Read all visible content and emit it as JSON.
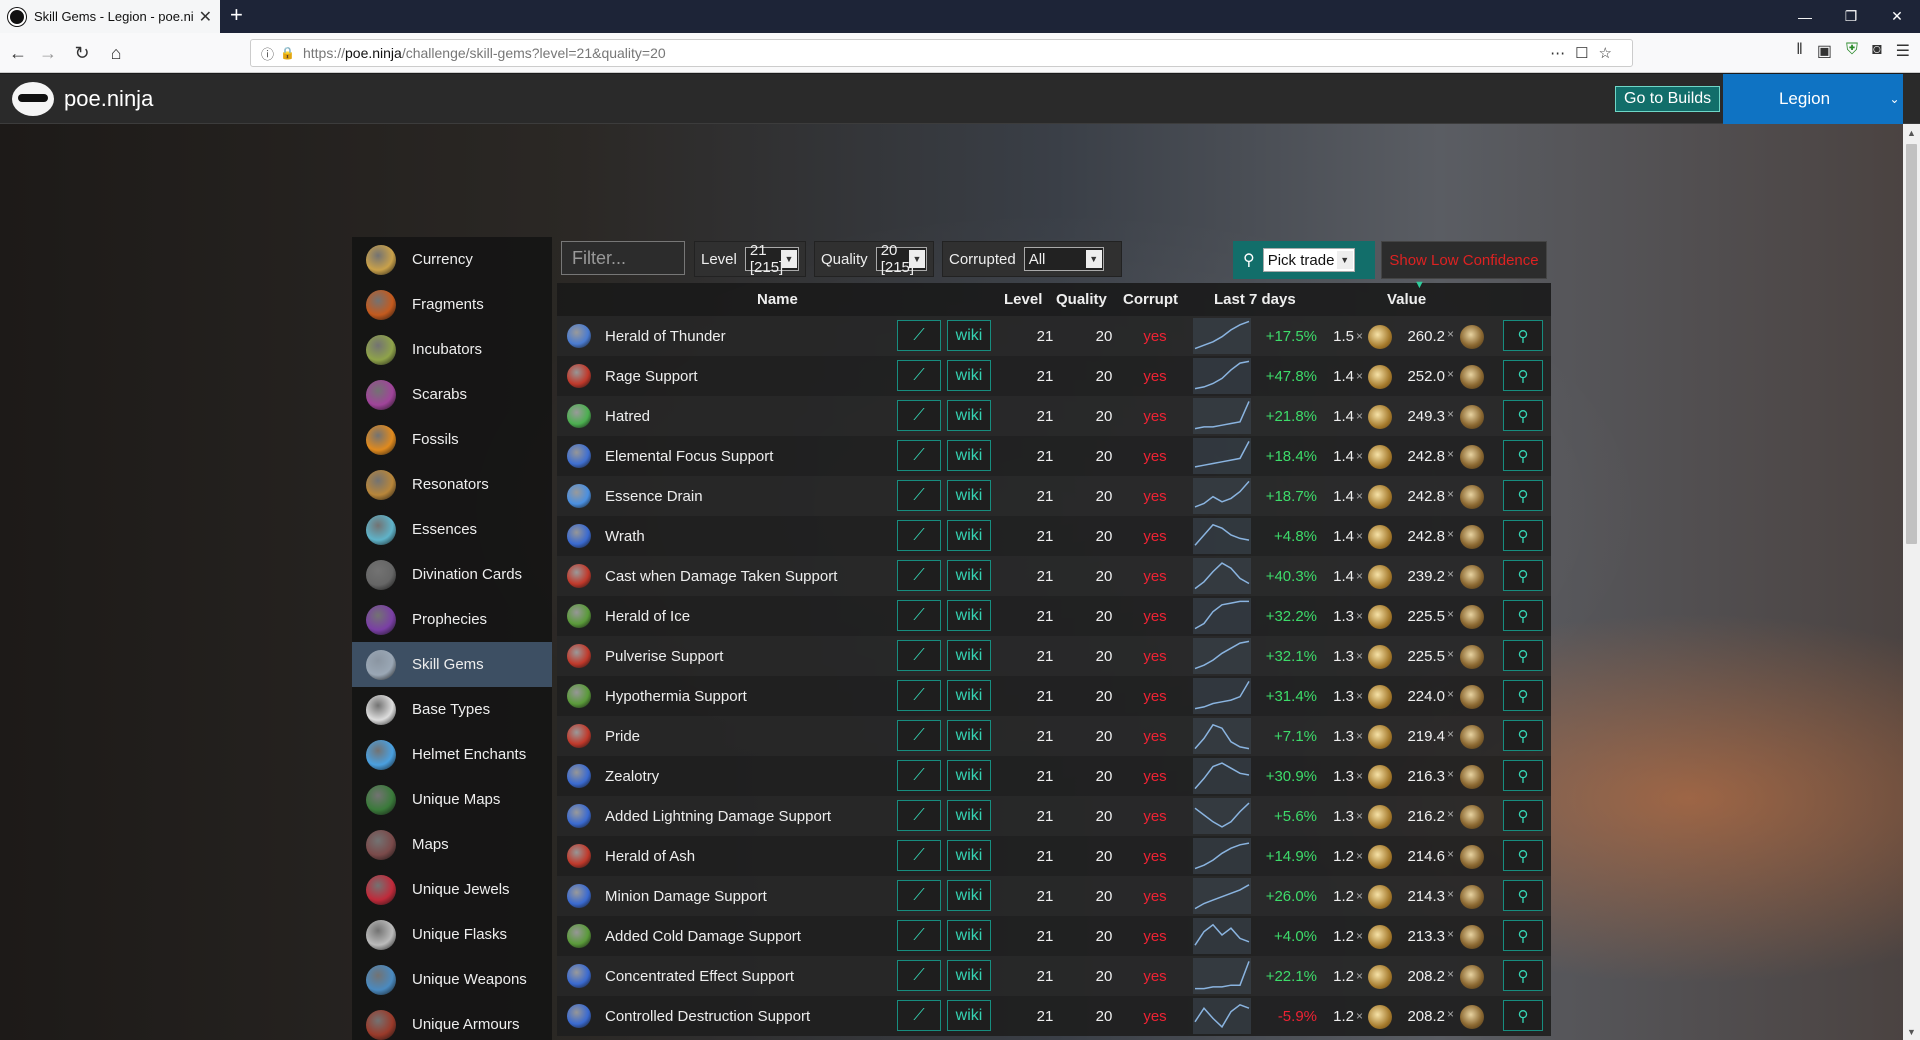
{
  "browser": {
    "tab_title": "Skill Gems - Legion - poe.ninj",
    "url_prefix": "https://",
    "url_domain": "poe.ninja",
    "url_path": "/challenge/skill-gems?level=21&quality=20"
  },
  "header": {
    "brand": "poe.ninja",
    "builds_button": "Go to Builds",
    "league": "Legion"
  },
  "sidebar": [
    {
      "label": "Currency",
      "color": "#c9a14a"
    },
    {
      "label": "Fragments",
      "color": "#c45a1e"
    },
    {
      "label": "Incubators",
      "color": "#8fa34a"
    },
    {
      "label": "Scarabs",
      "color": "#a0449a"
    },
    {
      "label": "Fossils",
      "color": "#e08a1e"
    },
    {
      "label": "Resonators",
      "color": "#b8863a"
    },
    {
      "label": "Essences",
      "color": "#5fb3c9"
    },
    {
      "label": "Divination Cards",
      "color": "#666666"
    },
    {
      "label": "Prophecies",
      "color": "#7a3fa5"
    },
    {
      "label": "Skill Gems",
      "color": "#9aa7b5",
      "active": true
    },
    {
      "label": "Base Types",
      "color": "#dddddd"
    },
    {
      "label": "Helmet Enchants",
      "color": "#4aa0e0"
    },
    {
      "label": "Unique Maps",
      "color": "#3a7a3a"
    },
    {
      "label": "Maps",
      "color": "#7a4a4a"
    },
    {
      "label": "Unique Jewels",
      "color": "#c02a3a"
    },
    {
      "label": "Unique Flasks",
      "color": "#bbbbbb"
    },
    {
      "label": "Unique Weapons",
      "color": "#4a8ac0"
    },
    {
      "label": "Unique Armours",
      "color": "#9a3a2a"
    }
  ],
  "controls": {
    "filter_placeholder": "Filter...",
    "level_label": "Level",
    "level_value": "21 [215]",
    "quality_label": "Quality",
    "quality_value": "20 [215]",
    "corrupted_label": "Corrupted",
    "corrupted_value": "All",
    "trade_value": "Pick trade",
    "low_confidence": "Show Low Confidence"
  },
  "table": {
    "headers": {
      "name": "Name",
      "level": "Level",
      "quality": "Quality",
      "corrupt": "Corrupt",
      "last7": "Last 7 days",
      "value": "Value"
    },
    "chart_button": "⟋",
    "wiki_button": "wiki",
    "rows": [
      {
        "name": "Herald of Thunder",
        "level": "21",
        "quality": "20",
        "corrupt": "yes",
        "change": "+17.5%",
        "ex": "1.5",
        "chaos": "260.2",
        "icon": "#4a7bd0",
        "spark": [
          2,
          4,
          6,
          9,
          13,
          16,
          18
        ]
      },
      {
        "name": "Rage Support",
        "level": "21",
        "quality": "20",
        "corrupt": "yes",
        "change": "+47.8%",
        "ex": "1.4",
        "chaos": "252.0",
        "icon": "#c0392b",
        "spark": [
          2,
          3,
          5,
          8,
          13,
          17,
          18
        ]
      },
      {
        "name": "Hatred",
        "level": "21",
        "quality": "20",
        "corrupt": "yes",
        "change": "+21.8%",
        "ex": "1.4",
        "chaos": "249.3",
        "icon": "#4caf50",
        "spark": [
          2,
          3,
          3,
          4,
          5,
          6,
          18
        ]
      },
      {
        "name": "Elemental Focus Support",
        "level": "21",
        "quality": "20",
        "corrupt": "yes",
        "change": "+18.4%",
        "ex": "1.4",
        "chaos": "242.8",
        "icon": "#3f6fd0",
        "spark": [
          3,
          4,
          5,
          6,
          7,
          8,
          18
        ]
      },
      {
        "name": "Essence Drain",
        "level": "21",
        "quality": "20",
        "corrupt": "yes",
        "change": "+18.7%",
        "ex": "1.4",
        "chaos": "242.8",
        "icon": "#4a8fe0",
        "spark": [
          3,
          5,
          9,
          6,
          8,
          12,
          18
        ]
      },
      {
        "name": "Wrath",
        "level": "21",
        "quality": "20",
        "corrupt": "yes",
        "change": "+4.8%",
        "ex": "1.4",
        "chaos": "242.8",
        "icon": "#3a6ad0",
        "spark": [
          4,
          10,
          16,
          14,
          10,
          8,
          7
        ]
      },
      {
        "name": "Cast when Damage Taken Support",
        "level": "21",
        "quality": "20",
        "corrupt": "yes",
        "change": "+40.3%",
        "ex": "1.4",
        "chaos": "239.2",
        "icon": "#c0392b",
        "spark": [
          2,
          6,
          12,
          17,
          14,
          8,
          5
        ]
      },
      {
        "name": "Herald of Ice",
        "level": "21",
        "quality": "20",
        "corrupt": "yes",
        "change": "+32.2%",
        "ex": "1.3",
        "chaos": "225.5",
        "icon": "#5a9a3a",
        "spark": [
          2,
          5,
          12,
          16,
          17,
          18,
          18
        ]
      },
      {
        "name": "Pulverise Support",
        "level": "21",
        "quality": "20",
        "corrupt": "yes",
        "change": "+32.1%",
        "ex": "1.3",
        "chaos": "225.5",
        "icon": "#c0392b",
        "spark": [
          2,
          4,
          7,
          11,
          14,
          17,
          18
        ]
      },
      {
        "name": "Hypothermia Support",
        "level": "21",
        "quality": "20",
        "corrupt": "yes",
        "change": "+31.4%",
        "ex": "1.3",
        "chaos": "224.0",
        "icon": "#5a9a3a",
        "spark": [
          2,
          3,
          5,
          6,
          7,
          9,
          18
        ]
      },
      {
        "name": "Pride",
        "level": "21",
        "quality": "20",
        "corrupt": "yes",
        "change": "+7.1%",
        "ex": "1.3",
        "chaos": "219.4",
        "icon": "#c0392b",
        "spark": [
          2,
          8,
          16,
          14,
          6,
          3,
          2
        ]
      },
      {
        "name": "Zealotry",
        "level": "21",
        "quality": "20",
        "corrupt": "yes",
        "change": "+30.9%",
        "ex": "1.3",
        "chaos": "216.3",
        "icon": "#3a6ad0",
        "spark": [
          2,
          8,
          15,
          17,
          14,
          11,
          10
        ]
      },
      {
        "name": "Added Lightning Damage Support",
        "level": "21",
        "quality": "20",
        "corrupt": "yes",
        "change": "+5.6%",
        "ex": "1.3",
        "chaos": "216.2",
        "icon": "#3a6ad0",
        "spark": [
          14,
          10,
          6,
          3,
          6,
          12,
          17
        ]
      },
      {
        "name": "Herald of Ash",
        "level": "21",
        "quality": "20",
        "corrupt": "yes",
        "change": "+14.9%",
        "ex": "1.2",
        "chaos": "214.6",
        "icon": "#c0392b",
        "spark": [
          2,
          4,
          7,
          11,
          14,
          16,
          17
        ]
      },
      {
        "name": "Minion Damage Support",
        "level": "21",
        "quality": "20",
        "corrupt": "yes",
        "change": "+26.0%",
        "ex": "1.2",
        "chaos": "214.3",
        "icon": "#3a6ad0",
        "spark": [
          2,
          5,
          7,
          9,
          11,
          13,
          16
        ]
      },
      {
        "name": "Added Cold Damage Support",
        "level": "21",
        "quality": "20",
        "corrupt": "yes",
        "change": "+4.0%",
        "ex": "1.2",
        "chaos": "213.3",
        "icon": "#5a9a3a",
        "spark": [
          4,
          12,
          16,
          10,
          14,
          8,
          6
        ]
      },
      {
        "name": "Concentrated Effect Support",
        "level": "21",
        "quality": "20",
        "corrupt": "yes",
        "change": "+22.1%",
        "ex": "1.2",
        "chaos": "208.2",
        "icon": "#3a6ad0",
        "spark": [
          2,
          2,
          3,
          3,
          4,
          4,
          18
        ]
      },
      {
        "name": "Controlled Destruction Support",
        "level": "21",
        "quality": "20",
        "corrupt": "yes",
        "change": "-5.9%",
        "ex": "1.2",
        "chaos": "208.2",
        "icon": "#3a6ad0",
        "spark": [
          6,
          14,
          8,
          3,
          12,
          16,
          14
        ]
      }
    ]
  }
}
